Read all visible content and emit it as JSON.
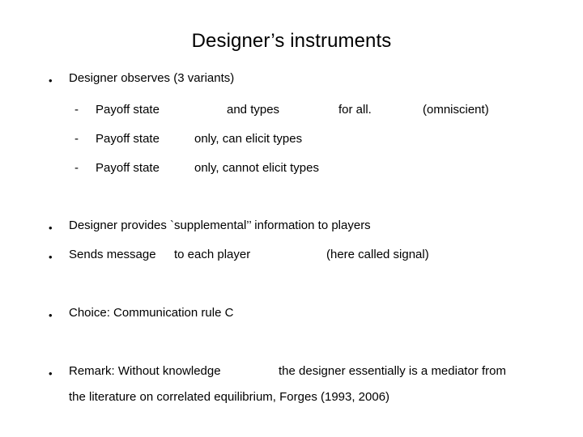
{
  "slide": {
    "title": "Designer’s instruments",
    "background_color": "#ffffff",
    "text_color": "#000000",
    "bullets": {
      "observes": {
        "marker": "•",
        "text": "Designer observes (3 variants)"
      },
      "variant1": {
        "marker": "-",
        "seg1": "Payoff state",
        "seg2": "and types",
        "seg3": "for all.",
        "seg4": "(omniscient)"
      },
      "variant2": {
        "marker": "-",
        "seg1": "Payoff state",
        "seg2": "only, can elicit types"
      },
      "variant3": {
        "marker": "-",
        "seg1": "Payoff state",
        "seg2": "only, cannot elicit types"
      },
      "supplemental": {
        "marker": "•",
        "text": "Designer provides `supplemental’’ information to players"
      },
      "sends_message": {
        "marker": "•",
        "seg1": "Sends message",
        "seg2": "to each player",
        "seg3": "(here called signal)"
      },
      "choice": {
        "marker": "•",
        "text": "Choice: Communication rule C"
      },
      "remark": {
        "marker": "•",
        "seg1": "Remark: Without knowledge",
        "seg2": "the designer essentially is a mediator from",
        "line2": "the literature on correlated equilibrium, Forges (1993, 2006)"
      }
    }
  }
}
